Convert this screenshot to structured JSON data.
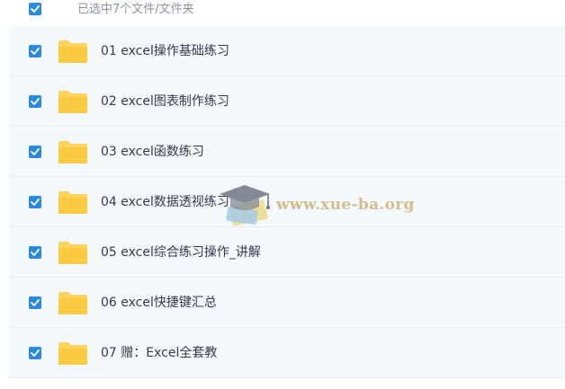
{
  "header": {
    "selection_label": "已选中7个文件/文件夹"
  },
  "files": [
    {
      "name": "01 excel操作基础练习"
    },
    {
      "name": "02 excel图表制作练习"
    },
    {
      "name": "03 excel函数练习"
    },
    {
      "name": "04 excel数据透视练习"
    },
    {
      "name": "05 excel综合练习操作_讲解"
    },
    {
      "name": "06 excel快捷键汇总"
    },
    {
      "name": "07 赠：Excel全套教"
    }
  ],
  "watermark": {
    "text": "www.xue-ba.org"
  },
  "colors": {
    "checkbox": "#2a8bde",
    "folder": "#fdd55d",
    "row_background": "#f4f9fe"
  },
  "icons": {
    "checkbox": "checkmark-icon",
    "folder": "folder-icon",
    "watermark": "graduation-cap-icon"
  }
}
